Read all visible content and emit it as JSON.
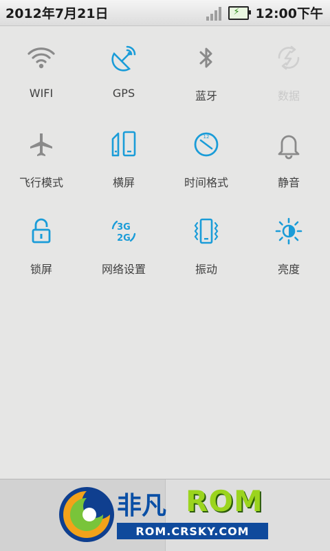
{
  "status": {
    "date": "2012年7月21日",
    "time": "12:00下午"
  },
  "toggles": [
    {
      "label": "WIFI",
      "icon": "wifi-icon",
      "enabled": false
    },
    {
      "label": "GPS",
      "icon": "gps-icon",
      "enabled": true
    },
    {
      "label": "蓝牙",
      "icon": "bluetooth-icon",
      "enabled": false
    },
    {
      "label": "数据",
      "icon": "data-icon",
      "enabled": false,
      "dimmed": true
    },
    {
      "label": "飞行模式",
      "icon": "airplane-icon",
      "enabled": false
    },
    {
      "label": "横屏",
      "icon": "rotate-screen-icon",
      "enabled": true
    },
    {
      "label": "时间格式",
      "icon": "clock-icon",
      "enabled": true
    },
    {
      "label": "静音",
      "icon": "bell-icon",
      "enabled": false
    },
    {
      "label": "锁屏",
      "icon": "lock-icon",
      "enabled": true
    },
    {
      "label": "网络设置",
      "icon": "network-3g2g-icon",
      "enabled": true
    },
    {
      "label": "振动",
      "icon": "vibrate-icon",
      "enabled": true
    },
    {
      "label": "亮度",
      "icon": "brightness-icon",
      "enabled": true
    }
  ],
  "watermark": {
    "brand_cn": "非凡",
    "brand_en": "ROM",
    "url": "ROM.CRSKY.COM"
  },
  "colors": {
    "accent_blue": "#1a9cd8",
    "inactive_gray": "#8a8a8a",
    "dimmed_gray": "#cfcfcf"
  }
}
